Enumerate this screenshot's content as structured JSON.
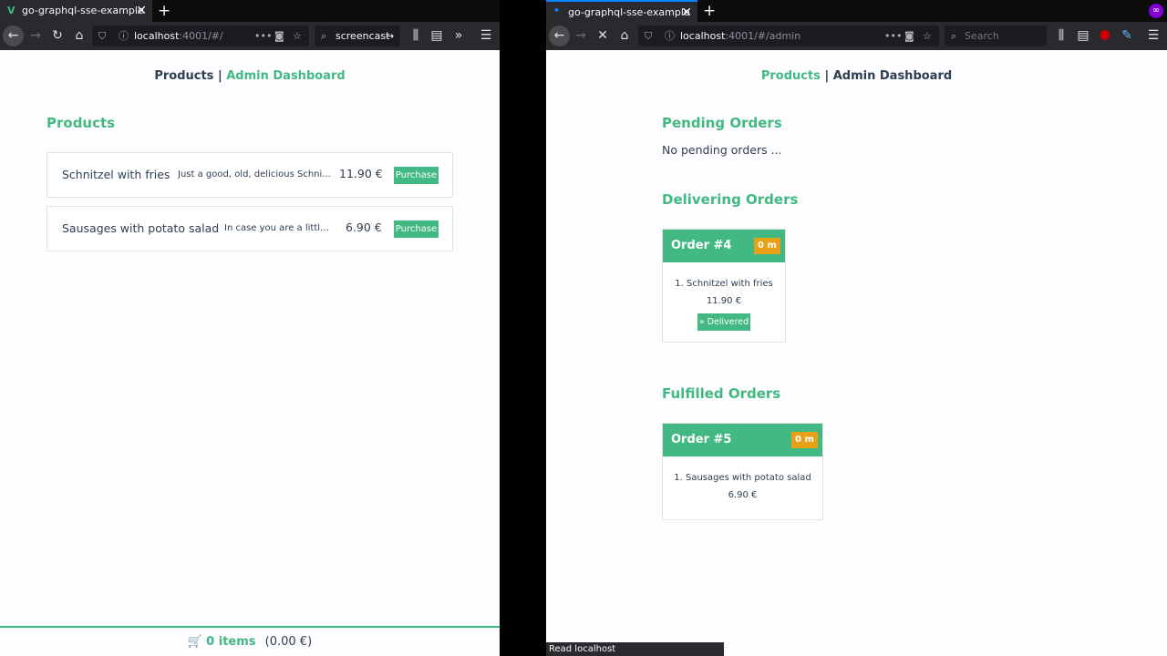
{
  "left_window": {
    "tab_title": "go-graphql-sse-example",
    "url_host": "localhost",
    "url_rest": ":4001/#/",
    "search_text": "screencast",
    "nav": {
      "products": "Products",
      "separator": "|",
      "admin": "Admin Dashboard"
    },
    "section_title": "Products",
    "products": [
      {
        "name": "Schnitzel with fries",
        "description": "Just a good, old, delicious Schni...",
        "price": "11.90 €",
        "action": "Purchase"
      },
      {
        "name": "Sausages with potato salad",
        "description": "In case you are a little...",
        "price": "6.90 €",
        "action": "Purchase"
      }
    ],
    "cart": {
      "count_label": "0 items",
      "total_label": "(0.00 €)"
    }
  },
  "right_window": {
    "tab_title": "go-graphql-sse-example",
    "url_host": "localhost",
    "url_rest": ":4001/#/admin",
    "search_placeholder": "Search",
    "nav": {
      "products": "Products",
      "separator": "|",
      "admin": "Admin Dashboard"
    },
    "pending": {
      "title": "Pending Orders",
      "empty_text": "No pending orders ..."
    },
    "delivering": {
      "title": "Delivering Orders",
      "orders": [
        {
          "title": "Order #4",
          "badge": "0 m",
          "item": "1. Schnitzel with fries",
          "price": "11.90 €",
          "action": "» Delivered"
        }
      ]
    },
    "fulfilled": {
      "title": "Fulfilled Orders",
      "orders": [
        {
          "title": "Order #5",
          "badge": "0 m",
          "item": "1. Sausages with potato salad",
          "price": "6.90 €"
        }
      ]
    },
    "status_text": "Read localhost"
  },
  "colors": {
    "accent": "#42b983",
    "text": "#2c3e50",
    "badge": "#e8a016"
  },
  "icons": {
    "back": "back-arrow-icon",
    "forward": "forward-arrow-icon",
    "reload": "reload-icon",
    "home": "home-icon",
    "shield": "shield-icon",
    "info": "info-icon",
    "cart": "cart-icon"
  }
}
